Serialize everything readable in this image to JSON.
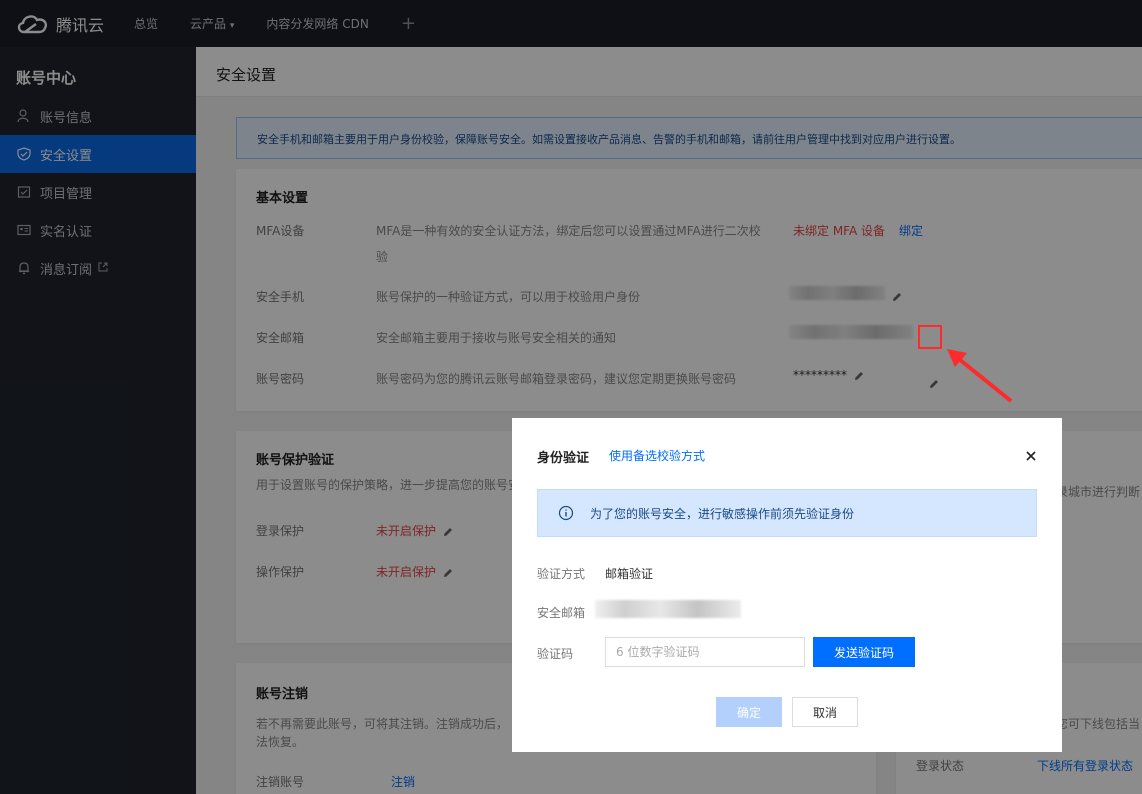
{
  "topbar": {
    "brand": "腾讯云",
    "nav": [
      "总览",
      "云产品",
      "内容分发网络 CDN"
    ],
    "add_icon": "+"
  },
  "sidebar": {
    "title": "账号中心",
    "items": [
      {
        "label": "账号信息",
        "icon": "user-icon"
      },
      {
        "label": "安全设置",
        "icon": "shield-icon",
        "active": true
      },
      {
        "label": "项目管理",
        "icon": "project-icon"
      },
      {
        "label": "实名认证",
        "icon": "id-card-icon"
      },
      {
        "label": "消息订阅",
        "icon": "bell-icon"
      }
    ]
  },
  "page": {
    "title": "安全设置",
    "notice": "安全手机和邮箱主要用于用户身份校验，保障账号安全。如需设置接收产品消息、告警的手机和邮箱，请前往用户管理中找到对应用户进行设置。"
  },
  "basic": {
    "title": "基本设置",
    "mfa": {
      "label": "MFA设备",
      "desc1": "MFA是一种有效的安全认证方法，绑定后您可以设置通过MFA进行二次校",
      "desc2": "验",
      "status": "未绑定 MFA 设备",
      "action": "绑定"
    },
    "phone": {
      "label": "安全手机",
      "desc": "账号保护的一种验证方式，可以用于校验用户身份"
    },
    "email": {
      "label": "安全邮箱",
      "desc": "安全邮箱主要用于接收与账号安全相关的通知"
    },
    "password": {
      "label": "账号密码",
      "desc": "账号密码为您的腾讯云账号邮箱登录密码，建议您定期更换账号密码",
      "value": "*********"
    }
  },
  "protect": {
    "title": "账号保护验证",
    "desc": "用于设置账号的保护策略，进一步提高您的账号安",
    "login": {
      "label": "登录保护",
      "status": "未开启保护"
    },
    "op": {
      "label": "操作保护",
      "status": "未开启保护"
    },
    "right_text": "录城市进行判断"
  },
  "cancel_card": {
    "title": "账号注销",
    "desc1": "若不再需要此账号，可将其注销。注销成功后，",
    "desc2": "法恢复。",
    "row_label": "注销账号",
    "row_action": "注销"
  },
  "login_card": {
    "right_text": "您可下线包括当",
    "row_label": "登录状态",
    "row_action": "下线所有登录状态"
  },
  "modal": {
    "title": "身份验证",
    "alt_link": "使用备选校验方式",
    "tip": "为了您的账号安全，进行敏感操作前须先验证身份",
    "method_label": "验证方式",
    "method_value": "邮箱验证",
    "email_label": "安全邮箱",
    "code_label": "验证码",
    "code_placeholder": "6 位数字验证码",
    "send_label": "发送验证码",
    "ok_label": "确定",
    "cancel_label": "取消"
  },
  "colors": {
    "primary": "#006eff",
    "danger": "#e54545",
    "sidebar": "#1f242e",
    "topbar": "#1a1e27"
  }
}
